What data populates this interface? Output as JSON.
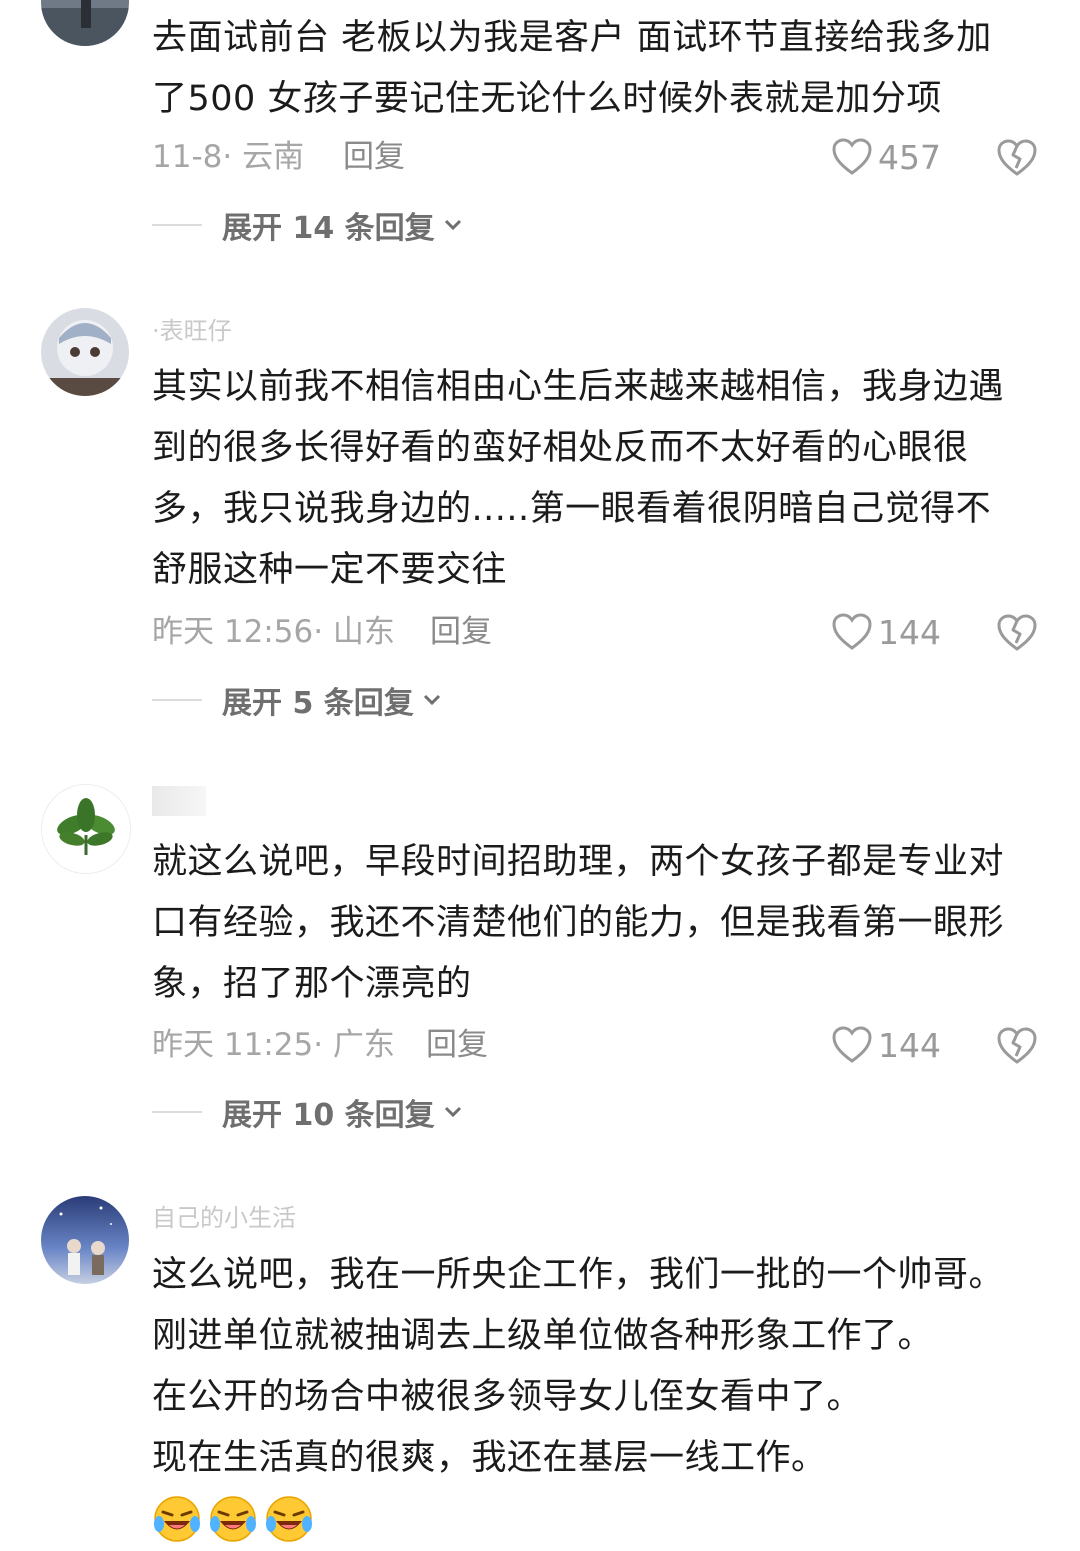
{
  "comments": [
    {
      "username": "",
      "lines": [
        "去面试前台 老板以为我是客户 面试环节直接给我多加",
        "了500 女孩子要记住无论什么时候外表就是加分项"
      ],
      "date_location": "11-8· 云南",
      "reply_label": "回复",
      "likes": "457",
      "expand_label": "展开 14 条回复"
    },
    {
      "username": "·表旺仔",
      "lines": [
        "其实以前我不相信相由心生后来越来越相信，我身边遇",
        "到的很多长得好看的蛮好相处反而不太好看的心眼很",
        "多，我只说我身边的.....第一眼看着很阴暗自己觉得不",
        "舒服这种一定不要交往"
      ],
      "date_location": "昨天 12:56· 山东",
      "reply_label": "回复",
      "likes": "144",
      "expand_label": "展开 5 条回复"
    },
    {
      "username": "",
      "lines": [
        "就这么说吧，早段时间招助理，两个女孩子都是专业对",
        "口有经验，我还不清楚他们的能力，但是我看第一眼形",
        "象，招了那个漂亮的"
      ],
      "date_location": "昨天 11:25· 广东",
      "reply_label": "回复",
      "likes": "144",
      "expand_label": "展开 10 条回复"
    },
    {
      "username": "自己的小生活",
      "lines": [
        "这么说吧，我在一所央企工作，我们一批的一个帅哥。",
        "刚进单位就被抽调去上级单位做各种形象工作了。",
        "在公开的场合中被很多领导女儿侄女看中了。",
        "现在生活真的很爽，我还在基层一线工作。"
      ],
      "emojis": [
        "😂",
        "😂",
        "😂"
      ]
    }
  ],
  "colors": {
    "text": "#1b1b1b",
    "meta": "#a6a6a6",
    "icon": "#9a9a9a"
  }
}
